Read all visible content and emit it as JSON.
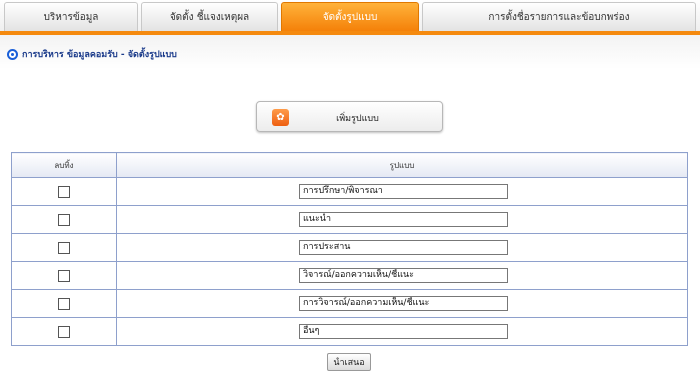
{
  "tabs": [
    {
      "label": "บริหารข้อมูล",
      "active": false
    },
    {
      "label": "จัดตั้ง ชี้แจงเหตุผล",
      "active": false
    },
    {
      "label": "จัดตั้งรูปแบบ",
      "active": true
    },
    {
      "label": "การตั้งชื่อรายการและข้อบกพร่อง",
      "active": false
    }
  ],
  "breadcrumb": "การบริหาร ข้อมูลคอมรับ - จัดตั้งรูปแบบ",
  "add_button": {
    "label": "เพิ่มรูปแบบ",
    "icon": "add-format-icon"
  },
  "table": {
    "headers": {
      "delete": "ลบทิ้ง",
      "format": "รูปแบบ"
    },
    "rows": [
      {
        "value": "การปรึกษา/พิจารณา",
        "checked": false
      },
      {
        "value": "แนะนำ",
        "checked": false
      },
      {
        "value": "การประสาน",
        "checked": false
      },
      {
        "value": "วิจารณ์/ออกความเห็น/ชี้แนะ",
        "checked": false
      },
      {
        "value": "การวิจารณ์/ออกความเห็น/ชี้แนะ",
        "checked": false
      },
      {
        "value": "อื่นๆ",
        "checked": false
      }
    ]
  },
  "submit_label": "นำเสนอ",
  "colors": {
    "accent": "#f58a0f",
    "table_border": "#8ea0cc",
    "breadcrumb_text": "#1a3a8a"
  }
}
